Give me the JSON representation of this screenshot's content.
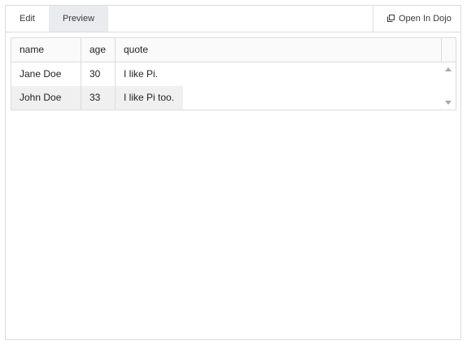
{
  "toolbar": {
    "tabs": [
      {
        "label": "Edit",
        "active": false
      },
      {
        "label": "Preview",
        "active": true
      }
    ],
    "open_in_dojo": {
      "label": "Open In Dojo",
      "icon": "external-window-icon"
    }
  },
  "grid": {
    "columns": [
      "name",
      "age",
      "quote"
    ],
    "rows": [
      {
        "name": "Jane Doe",
        "age": "30",
        "quote": "I like Pi."
      },
      {
        "name": "John Doe",
        "age": "33",
        "quote": "I like Pi too."
      }
    ]
  },
  "colors": {
    "border": "#dcdcdc",
    "active_tab_bg": "#e9ebee",
    "selected_row_bg": "#f0f0f0",
    "text": "#222222"
  }
}
